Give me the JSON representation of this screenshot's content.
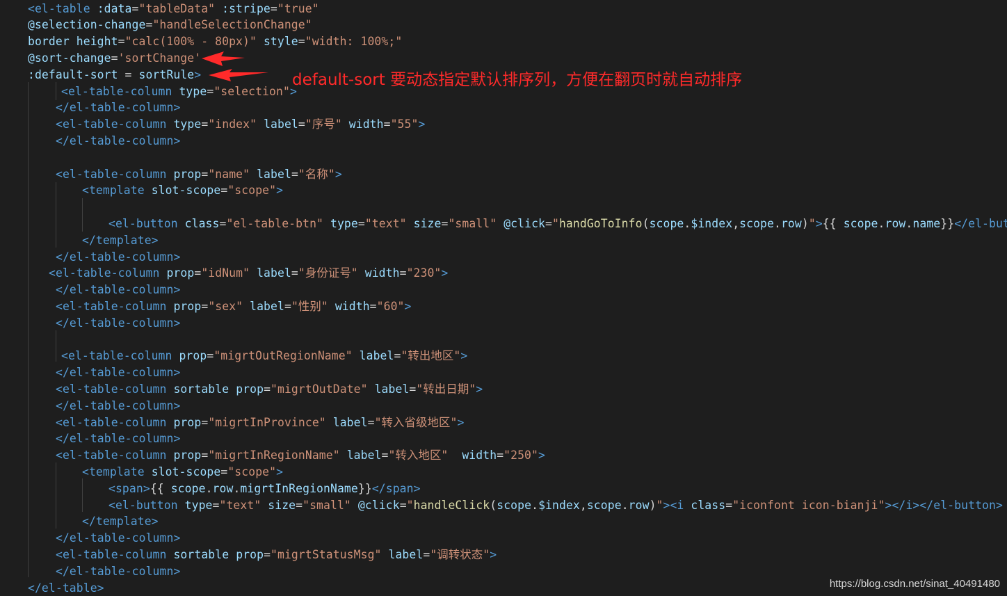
{
  "colors": {
    "background": "#1e1e1e",
    "tag": "#569cd6",
    "attr": "#9cdcfe",
    "string": "#ce9178",
    "text": "#d4d4d4",
    "fn": "#dcdcaa",
    "annotation": "#ff2a2a"
  },
  "code_lines": [
    {
      "indent": 40,
      "tokens": [
        [
          "<el-table",
          "tag"
        ],
        [
          " ",
          "text"
        ],
        [
          ":data",
          "attr"
        ],
        [
          "=",
          "text"
        ],
        [
          "\"tableData\"",
          "str"
        ],
        [
          " ",
          "text"
        ],
        [
          ":stripe",
          "attr"
        ],
        [
          "=",
          "text"
        ],
        [
          "\"true\"",
          "str"
        ]
      ]
    },
    {
      "indent": 40,
      "tokens": [
        [
          "@selection-change",
          "attr"
        ],
        [
          "=",
          "text"
        ],
        [
          "\"handleSelectionChange\"",
          "str"
        ]
      ]
    },
    {
      "indent": 40,
      "tokens": [
        [
          "border",
          "attr"
        ],
        [
          " ",
          "text"
        ],
        [
          "height",
          "attr"
        ],
        [
          "=",
          "text"
        ],
        [
          "\"calc(100% - 80px)\"",
          "str"
        ],
        [
          " ",
          "text"
        ],
        [
          "style",
          "attr"
        ],
        [
          "=",
          "text"
        ],
        [
          "\"width: 100%;\"",
          "str"
        ]
      ]
    },
    {
      "indent": 40,
      "tokens": [
        [
          "@sort-change",
          "attr"
        ],
        [
          "=",
          "text"
        ],
        [
          "'sortChange'",
          "str"
        ]
      ]
    },
    {
      "indent": 40,
      "tokens": [
        [
          ":default-sort",
          "attr"
        ],
        [
          " = ",
          "text"
        ],
        [
          "sortRule",
          "attr"
        ],
        [
          ">",
          "tag"
        ]
      ]
    },
    {
      "indent": 88,
      "tokens": [
        [
          "<el-table-column",
          "tag"
        ],
        [
          " ",
          "text"
        ],
        [
          "type",
          "attr"
        ],
        [
          "=",
          "text"
        ],
        [
          "\"selection\"",
          "str"
        ],
        [
          ">",
          "tag"
        ]
      ]
    },
    {
      "indent": 80,
      "tokens": [
        [
          "</el-table-column>",
          "tag"
        ]
      ]
    },
    {
      "indent": 80,
      "tokens": [
        [
          "<el-table-column",
          "tag"
        ],
        [
          " ",
          "text"
        ],
        [
          "type",
          "attr"
        ],
        [
          "=",
          "text"
        ],
        [
          "\"index\"",
          "str"
        ],
        [
          " ",
          "text"
        ],
        [
          "label",
          "attr"
        ],
        [
          "=",
          "text"
        ],
        [
          "\"序号\"",
          "str"
        ],
        [
          " ",
          "text"
        ],
        [
          "width",
          "attr"
        ],
        [
          "=",
          "text"
        ],
        [
          "\"55\"",
          "str"
        ],
        [
          ">",
          "tag"
        ]
      ]
    },
    {
      "indent": 80,
      "tokens": [
        [
          "</el-table-column>",
          "tag"
        ]
      ]
    },
    {
      "indent": 80,
      "tokens": []
    },
    {
      "indent": 80,
      "tokens": [
        [
          "<el-table-column",
          "tag"
        ],
        [
          " ",
          "text"
        ],
        [
          "prop",
          "attr"
        ],
        [
          "=",
          "text"
        ],
        [
          "\"name\"",
          "str"
        ],
        [
          " ",
          "text"
        ],
        [
          "label",
          "attr"
        ],
        [
          "=",
          "text"
        ],
        [
          "\"名称\"",
          "str"
        ],
        [
          ">",
          "tag"
        ]
      ]
    },
    {
      "indent": 118,
      "tokens": [
        [
          "<template",
          "tag"
        ],
        [
          " ",
          "text"
        ],
        [
          "slot-scope",
          "attr"
        ],
        [
          "=",
          "text"
        ],
        [
          "\"scope\"",
          "str"
        ],
        [
          ">",
          "tag"
        ]
      ]
    },
    {
      "indent": 118,
      "tokens": []
    },
    {
      "indent": 156,
      "tokens": [
        [
          "<el-button",
          "tag"
        ],
        [
          " ",
          "text"
        ],
        [
          "class",
          "attr"
        ],
        [
          "=",
          "text"
        ],
        [
          "\"el-table-btn\"",
          "str"
        ],
        [
          " ",
          "text"
        ],
        [
          "type",
          "attr"
        ],
        [
          "=",
          "text"
        ],
        [
          "\"text\"",
          "str"
        ],
        [
          " ",
          "text"
        ],
        [
          "size",
          "attr"
        ],
        [
          "=",
          "text"
        ],
        [
          "\"small\"",
          "str"
        ],
        [
          " ",
          "text"
        ],
        [
          "@click",
          "attr"
        ],
        [
          "=",
          "text"
        ],
        [
          "\"",
          "str"
        ],
        [
          "handGoToInfo",
          "fn"
        ],
        [
          "(",
          "text"
        ],
        [
          "scope",
          "attr"
        ],
        [
          ".",
          "text"
        ],
        [
          "$index",
          "attr"
        ],
        [
          ",",
          "text"
        ],
        [
          "scope",
          "attr"
        ],
        [
          ".",
          "text"
        ],
        [
          "row",
          "attr"
        ],
        [
          ")",
          "text"
        ],
        [
          "\"",
          "str"
        ],
        [
          ">",
          "tag"
        ],
        [
          "{{ ",
          "text"
        ],
        [
          "scope",
          "attr"
        ],
        [
          ".",
          "text"
        ],
        [
          "row",
          "attr"
        ],
        [
          ".",
          "text"
        ],
        [
          "name",
          "attr"
        ],
        [
          "}}",
          "text"
        ],
        [
          "</el-button>",
          "tag"
        ]
      ]
    },
    {
      "indent": 118,
      "tokens": [
        [
          "</template>",
          "tag"
        ]
      ]
    },
    {
      "indent": 80,
      "tokens": [
        [
          "</el-table-column>",
          "tag"
        ]
      ]
    },
    {
      "indent": 70,
      "tokens": [
        [
          "<el-table-column",
          "tag"
        ],
        [
          " ",
          "text"
        ],
        [
          "prop",
          "attr"
        ],
        [
          "=",
          "text"
        ],
        [
          "\"idNum\"",
          "str"
        ],
        [
          " ",
          "text"
        ],
        [
          "label",
          "attr"
        ],
        [
          "=",
          "text"
        ],
        [
          "\"身份证号\"",
          "str"
        ],
        [
          " ",
          "text"
        ],
        [
          "width",
          "attr"
        ],
        [
          "=",
          "text"
        ],
        [
          "\"230\"",
          "str"
        ],
        [
          ">",
          "tag"
        ]
      ]
    },
    {
      "indent": 80,
      "tokens": [
        [
          "</el-table-column>",
          "tag"
        ]
      ]
    },
    {
      "indent": 80,
      "tokens": [
        [
          "<el-table-column",
          "tag"
        ],
        [
          " ",
          "text"
        ],
        [
          "prop",
          "attr"
        ],
        [
          "=",
          "text"
        ],
        [
          "\"sex\"",
          "str"
        ],
        [
          " ",
          "text"
        ],
        [
          "label",
          "attr"
        ],
        [
          "=",
          "text"
        ],
        [
          "\"性别\"",
          "str"
        ],
        [
          " ",
          "text"
        ],
        [
          "width",
          "attr"
        ],
        [
          "=",
          "text"
        ],
        [
          "\"60\"",
          "str"
        ],
        [
          ">",
          "tag"
        ]
      ]
    },
    {
      "indent": 80,
      "tokens": [
        [
          "</el-table-column>",
          "tag"
        ]
      ]
    },
    {
      "indent": 80,
      "tokens": []
    },
    {
      "indent": 88,
      "tokens": [
        [
          "<el-table-column",
          "tag"
        ],
        [
          " ",
          "text"
        ],
        [
          "prop",
          "attr"
        ],
        [
          "=",
          "text"
        ],
        [
          "\"migrtOutRegionName\"",
          "str"
        ],
        [
          " ",
          "text"
        ],
        [
          "label",
          "attr"
        ],
        [
          "=",
          "text"
        ],
        [
          "\"转出地区\"",
          "str"
        ],
        [
          ">",
          "tag"
        ]
      ]
    },
    {
      "indent": 80,
      "tokens": [
        [
          "</el-table-column>",
          "tag"
        ]
      ]
    },
    {
      "indent": 80,
      "tokens": [
        [
          "<el-table-column",
          "tag"
        ],
        [
          " ",
          "text"
        ],
        [
          "sortable",
          "attr"
        ],
        [
          " ",
          "text"
        ],
        [
          "prop",
          "attr"
        ],
        [
          "=",
          "text"
        ],
        [
          "\"migrtOutDate\"",
          "str"
        ],
        [
          " ",
          "text"
        ],
        [
          "label",
          "attr"
        ],
        [
          "=",
          "text"
        ],
        [
          "\"转出日期\"",
          "str"
        ],
        [
          ">",
          "tag"
        ]
      ]
    },
    {
      "indent": 80,
      "tokens": [
        [
          "</el-table-column>",
          "tag"
        ]
      ]
    },
    {
      "indent": 80,
      "tokens": [
        [
          "<el-table-column",
          "tag"
        ],
        [
          " ",
          "text"
        ],
        [
          "prop",
          "attr"
        ],
        [
          "=",
          "text"
        ],
        [
          "\"migrtInProvince\"",
          "str"
        ],
        [
          " ",
          "text"
        ],
        [
          "label",
          "attr"
        ],
        [
          "=",
          "text"
        ],
        [
          "\"转入省级地区\"",
          "str"
        ],
        [
          ">",
          "tag"
        ]
      ]
    },
    {
      "indent": 80,
      "tokens": [
        [
          "</el-table-column>",
          "tag"
        ]
      ]
    },
    {
      "indent": 80,
      "tokens": [
        [
          "<el-table-column",
          "tag"
        ],
        [
          " ",
          "text"
        ],
        [
          "prop",
          "attr"
        ],
        [
          "=",
          "text"
        ],
        [
          "\"migrtInRegionName\"",
          "str"
        ],
        [
          " ",
          "text"
        ],
        [
          "label",
          "attr"
        ],
        [
          "=",
          "text"
        ],
        [
          "\"转入地区\"",
          "str"
        ],
        [
          "  ",
          "text"
        ],
        [
          "width",
          "attr"
        ],
        [
          "=",
          "text"
        ],
        [
          "\"250\"",
          "str"
        ],
        [
          ">",
          "tag"
        ]
      ]
    },
    {
      "indent": 118,
      "tokens": [
        [
          "<template",
          "tag"
        ],
        [
          " ",
          "text"
        ],
        [
          "slot-scope",
          "attr"
        ],
        [
          "=",
          "text"
        ],
        [
          "\"scope\"",
          "str"
        ],
        [
          ">",
          "tag"
        ]
      ]
    },
    {
      "indent": 156,
      "tokens": [
        [
          "<span>",
          "tag"
        ],
        [
          "{{ ",
          "text"
        ],
        [
          "scope",
          "attr"
        ],
        [
          ".",
          "text"
        ],
        [
          "row",
          "attr"
        ],
        [
          ".",
          "text"
        ],
        [
          "migrtInRegionName",
          "attr"
        ],
        [
          "}}",
          "text"
        ],
        [
          "</span>",
          "tag"
        ]
      ]
    },
    {
      "indent": 156,
      "tokens": [
        [
          "<el-button",
          "tag"
        ],
        [
          " ",
          "text"
        ],
        [
          "type",
          "attr"
        ],
        [
          "=",
          "text"
        ],
        [
          "\"text\"",
          "str"
        ],
        [
          " ",
          "text"
        ],
        [
          "size",
          "attr"
        ],
        [
          "=",
          "text"
        ],
        [
          "\"small\"",
          "str"
        ],
        [
          " ",
          "text"
        ],
        [
          "@click",
          "attr"
        ],
        [
          "=",
          "text"
        ],
        [
          "\"",
          "str"
        ],
        [
          "handleClick",
          "fn"
        ],
        [
          "(",
          "text"
        ],
        [
          "scope",
          "attr"
        ],
        [
          ".",
          "text"
        ],
        [
          "$index",
          "attr"
        ],
        [
          ",",
          "text"
        ],
        [
          "scope",
          "attr"
        ],
        [
          ".",
          "text"
        ],
        [
          "row",
          "attr"
        ],
        [
          ")",
          "text"
        ],
        [
          "\"",
          "str"
        ],
        [
          ">",
          "tag"
        ],
        [
          "<i",
          "tag"
        ],
        [
          " ",
          "text"
        ],
        [
          "class",
          "attr"
        ],
        [
          "=",
          "text"
        ],
        [
          "\"iconfont icon-bianji\"",
          "str"
        ],
        [
          ">",
          "tag"
        ],
        [
          "</i>",
          "tag"
        ],
        [
          "</el-button>",
          "tag"
        ]
      ]
    },
    {
      "indent": 118,
      "tokens": [
        [
          "</template>",
          "tag"
        ]
      ]
    },
    {
      "indent": 80,
      "tokens": [
        [
          "</el-table-column>",
          "tag"
        ]
      ]
    },
    {
      "indent": 80,
      "tokens": [
        [
          "<el-table-column",
          "tag"
        ],
        [
          " ",
          "text"
        ],
        [
          "sortable",
          "attr"
        ],
        [
          " ",
          "text"
        ],
        [
          "prop",
          "attr"
        ],
        [
          "=",
          "text"
        ],
        [
          "\"migrtStatusMsg\"",
          "str"
        ],
        [
          " ",
          "text"
        ],
        [
          "label",
          "attr"
        ],
        [
          "=",
          "text"
        ],
        [
          "\"调转状态\"",
          "str"
        ],
        [
          ">",
          "tag"
        ]
      ]
    },
    {
      "indent": 80,
      "tokens": [
        [
          "</el-table-column>",
          "tag"
        ]
      ]
    },
    {
      "indent": 40,
      "tokens": [
        [
          "</el-table>",
          "tag"
        ]
      ]
    }
  ],
  "annotation": {
    "text": "default-sort 要动态指定默认排序列，方便在翻页时就自动排序"
  },
  "watermark": "https://blog.csdn.net/sinat_40491480"
}
